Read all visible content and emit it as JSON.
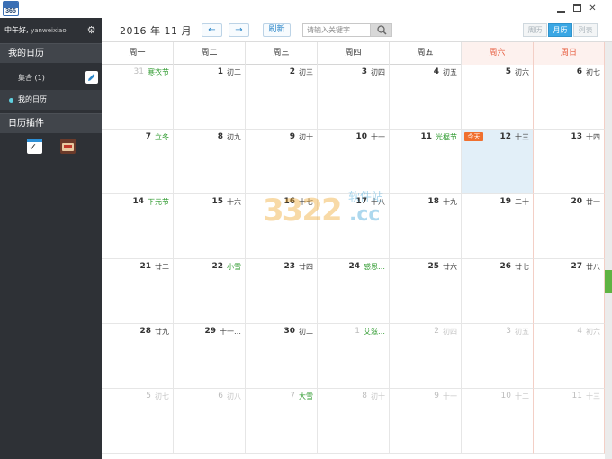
{
  "window": {
    "logo_text": "365",
    "min_label": "",
    "max_label": "",
    "close_label": "✕"
  },
  "sidebar": {
    "greeting": "中午好,",
    "username": "yanweixiao",
    "my_calendars_title": "我的日历",
    "collection_label": "集合 (1)",
    "my_calendar_label": "我的日历",
    "plugins_title": "日历插件",
    "icons": [
      "gear-icon",
      "pencil-icon",
      "calendar-check-icon",
      "book-icon"
    ]
  },
  "toolbar": {
    "month_label": "2016 年 11 月",
    "prev_label": "←",
    "next_label": "→",
    "refresh_label": "刷新",
    "search_placeholder": "请输入关键字",
    "view_day": "周历",
    "view_month": "月历",
    "view_list": "列表"
  },
  "weekdays": [
    "周一",
    "周二",
    "周三",
    "周四",
    "周五",
    "周六",
    "周日"
  ],
  "today_badge": "今天",
  "weeks": [
    [
      {
        "day": "31",
        "lunar": "寒衣节",
        "muted": true,
        "festival": true
      },
      {
        "day": "1",
        "lunar": "初二"
      },
      {
        "day": "2",
        "lunar": "初三"
      },
      {
        "day": "3",
        "lunar": "初四"
      },
      {
        "day": "4",
        "lunar": "初五"
      },
      {
        "day": "5",
        "lunar": "初六"
      },
      {
        "day": "6",
        "lunar": "初七"
      }
    ],
    [
      {
        "day": "7",
        "lunar": "立冬",
        "festival": true
      },
      {
        "day": "8",
        "lunar": "初九"
      },
      {
        "day": "9",
        "lunar": "初十"
      },
      {
        "day": "10",
        "lunar": "十一"
      },
      {
        "day": "11",
        "lunar": "光棍节",
        "festival": true
      },
      {
        "day": "12",
        "lunar": "十三",
        "today": true
      },
      {
        "day": "13",
        "lunar": "十四"
      }
    ],
    [
      {
        "day": "14",
        "lunar": "下元节",
        "festival": true
      },
      {
        "day": "15",
        "lunar": "十六"
      },
      {
        "day": "16",
        "lunar": "十七"
      },
      {
        "day": "17",
        "lunar": "十八"
      },
      {
        "day": "18",
        "lunar": "十九"
      },
      {
        "day": "19",
        "lunar": "二十"
      },
      {
        "day": "20",
        "lunar": "廿一"
      }
    ],
    [
      {
        "day": "21",
        "lunar": "廿二"
      },
      {
        "day": "22",
        "lunar": "小雪",
        "festival": true
      },
      {
        "day": "23",
        "lunar": "廿四"
      },
      {
        "day": "24",
        "lunar": "感恩…",
        "festival": true
      },
      {
        "day": "25",
        "lunar": "廿六"
      },
      {
        "day": "26",
        "lunar": "廿七"
      },
      {
        "day": "27",
        "lunar": "廿八"
      }
    ],
    [
      {
        "day": "28",
        "lunar": "廿九"
      },
      {
        "day": "29",
        "lunar": "十一…"
      },
      {
        "day": "30",
        "lunar": "初二"
      },
      {
        "day": "1",
        "lunar": "艾滋…",
        "muted": true,
        "festival": true
      },
      {
        "day": "2",
        "lunar": "初四",
        "muted": true
      },
      {
        "day": "3",
        "lunar": "初五",
        "muted": true
      },
      {
        "day": "4",
        "lunar": "初六",
        "muted": true
      }
    ],
    [
      {
        "day": "5",
        "lunar": "初七",
        "muted": true
      },
      {
        "day": "6",
        "lunar": "初八",
        "muted": true
      },
      {
        "day": "7",
        "lunar": "大雪",
        "muted": true,
        "festival": true
      },
      {
        "day": "8",
        "lunar": "初十",
        "muted": true
      },
      {
        "day": "9",
        "lunar": "十一",
        "muted": true
      },
      {
        "day": "10",
        "lunar": "十二",
        "muted": true
      },
      {
        "day": "11",
        "lunar": "十三",
        "muted": true
      }
    ]
  ],
  "watermark": {
    "number": "3322",
    "domain": ".cc",
    "site": "软件站"
  },
  "colors": {
    "sidebar_bg": "#2e3136",
    "accent_blue": "#3aa7e4",
    "weekend_red": "#e65a3c",
    "festival_green": "#2e9a2e",
    "today_badge": "#f0702f",
    "today_cell": "#e2eff8"
  }
}
